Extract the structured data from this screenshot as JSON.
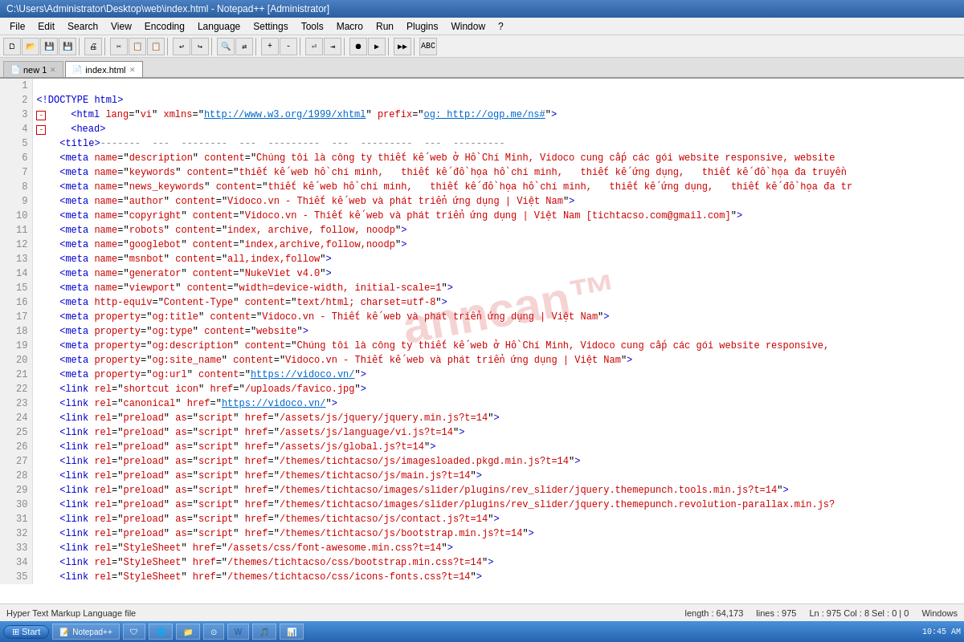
{
  "titlebar": {
    "text": "C:\\Users\\Administrator\\Desktop\\web\\index.html - Notepad++ [Administrator]"
  },
  "menubar": {
    "items": [
      "File",
      "Edit",
      "Search",
      "View",
      "Encoding",
      "Language",
      "Settings",
      "Tools",
      "Macro",
      "Run",
      "Plugins",
      "Window",
      "?"
    ]
  },
  "tabs": [
    {
      "label": "new 1",
      "active": false,
      "icon": "📄"
    },
    {
      "label": "index.html",
      "active": true,
      "icon": "📄"
    }
  ],
  "statusbar": {
    "filetype": "Hyper Text Markup Language file",
    "length": "length : 64,173",
    "lines": "lines : 975",
    "position": "Ln : 975   Col : 8   Sel : 0 | 0",
    "encoding": "Windows"
  },
  "watermark": "anncan™",
  "taskbar": {
    "start_label": "Start",
    "items": [
      "Notepad++",
      "W Word",
      "Chrome",
      "Explorer"
    ],
    "time": "10:45 AM"
  }
}
